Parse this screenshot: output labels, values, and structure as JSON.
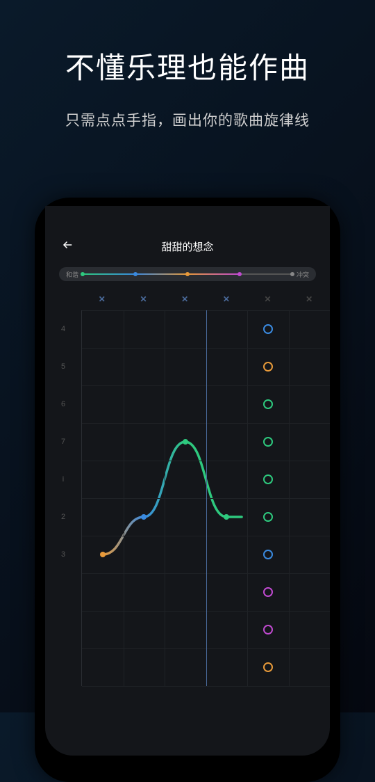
{
  "hero": {
    "title": "不懂乐理也能作曲",
    "subtitle": "只需点点手指，画出你的歌曲旋律线"
  },
  "app": {
    "title": "甜甜的想念",
    "slider": {
      "left_label": "和谐",
      "right_label": "冲突",
      "stops": [
        {
          "pos": 0,
          "color": "#2ec97e"
        },
        {
          "pos": 25,
          "color": "#3a8ae0"
        },
        {
          "pos": 50,
          "color": "#e89a3a"
        },
        {
          "pos": 75,
          "color": "#c04ad0"
        },
        {
          "pos": 100,
          "color": "#888888"
        }
      ],
      "segments": [
        {
          "from": 0,
          "to": 25,
          "color_from": "#2ec97e",
          "color_to": "#3a8ae0"
        },
        {
          "from": 25,
          "to": 50,
          "color_from": "#3a8ae0",
          "color_to": "#e89a3a"
        },
        {
          "from": 50,
          "to": 75,
          "color_from": "#e89a3a",
          "color_to": "#c04ad0"
        },
        {
          "from": 75,
          "to": 100,
          "color": "#555"
        }
      ]
    },
    "columns": 6,
    "close_marks": [
      {
        "active": true
      },
      {
        "active": true
      },
      {
        "active": true
      },
      {
        "active": true
      },
      {
        "active": false
      },
      {
        "active": false
      }
    ],
    "y_labels": [
      "4",
      "5",
      "6",
      "7",
      "i",
      "2",
      "3",
      "",
      "",
      ""
    ],
    "chart_data": {
      "type": "line",
      "x": [
        0,
        1,
        2,
        3
      ],
      "y": [
        6,
        5,
        3,
        5
      ],
      "colors": [
        "#e89a3a",
        "#3a8ae0",
        "#2ec97e",
        "#2ec97e"
      ],
      "playhead_col": 3,
      "palette_column": 4,
      "palette": [
        {
          "row": 0,
          "color": "#3a8ae0"
        },
        {
          "row": 1,
          "color": "#e89a3a"
        },
        {
          "row": 2,
          "color": "#2ec97e"
        },
        {
          "row": 3,
          "color": "#2ec97e"
        },
        {
          "row": 4,
          "color": "#2ec97e"
        },
        {
          "row": 5,
          "color": "#2ec97e"
        },
        {
          "row": 6,
          "color": "#3a8ae0"
        },
        {
          "row": 7,
          "color": "#c04ad0"
        },
        {
          "row": 8,
          "color": "#c04ad0"
        },
        {
          "row": 9,
          "color": "#e89a3a"
        }
      ]
    }
  }
}
